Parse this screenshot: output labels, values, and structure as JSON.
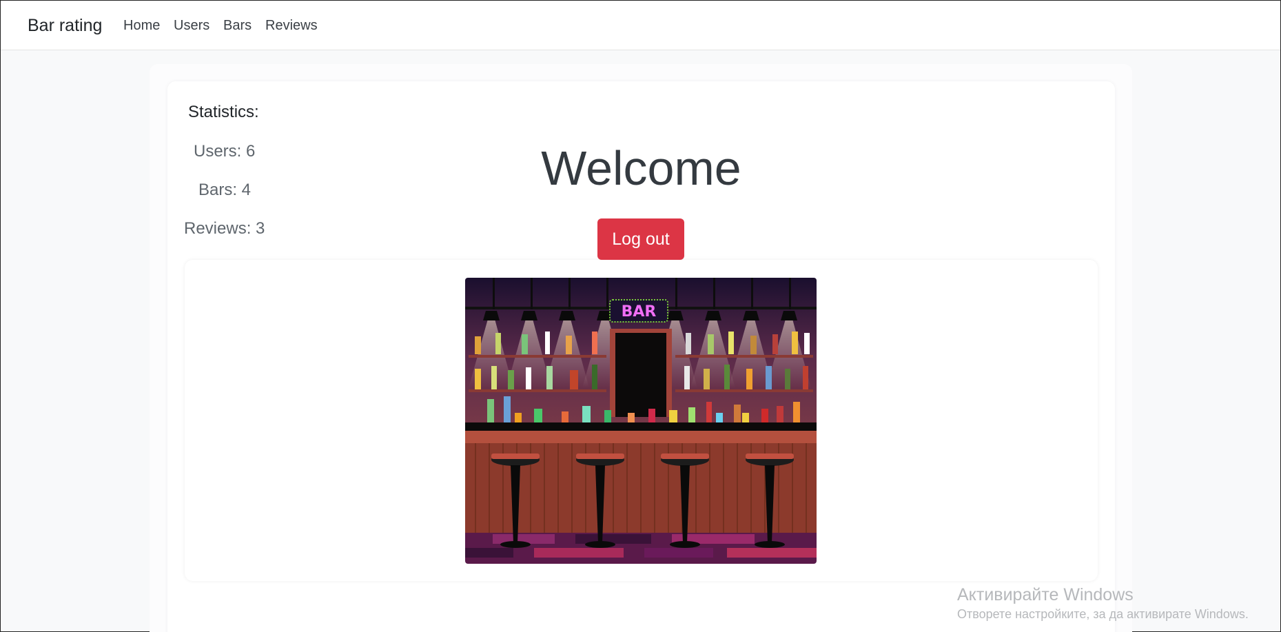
{
  "nav": {
    "brand": "Bar rating",
    "links": [
      "Home",
      "Users",
      "Bars",
      "Reviews"
    ]
  },
  "statistics": {
    "title": "Statistics:",
    "users": "Users: 6",
    "bars": "Bars: 4",
    "reviews": "Reviews: 3"
  },
  "main": {
    "heading": "Welcome",
    "logout_label": "Log out",
    "image_sign": "BAR"
  },
  "colors": {
    "logout_bg": "#dc3545",
    "page_bg": "#f8f9fa"
  },
  "watermark": {
    "line1": "Активирайте Windows",
    "line2": "Отворете настройките, за да активирате Windows."
  }
}
